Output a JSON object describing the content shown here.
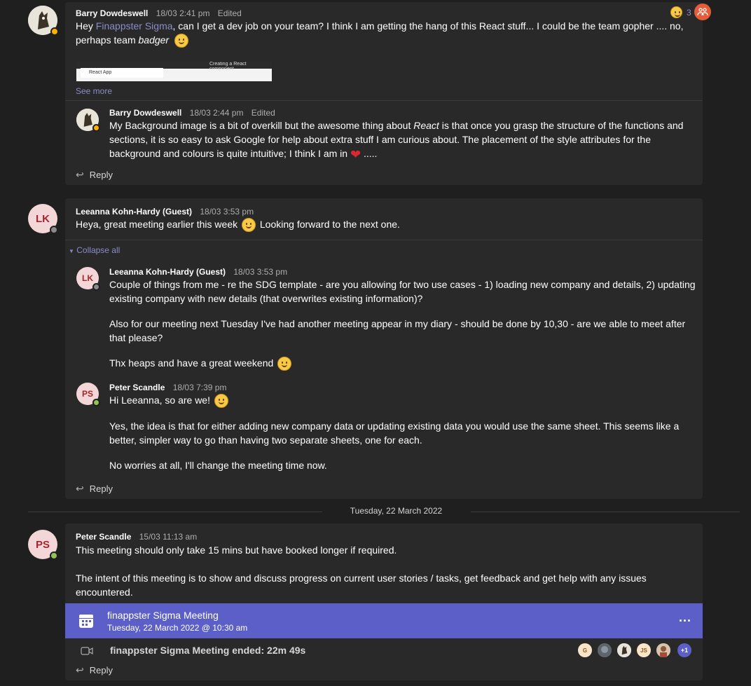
{
  "thread1": {
    "author": "Barry Dowdeswell",
    "time": "18/03 2:41 pm",
    "edited": "Edited",
    "text_pre": "Hey ",
    "mention": "Finappster Sigma",
    "text_post": ", can I get a dev job on your team? I think I am getting the hang of this React stuff... I could be the team gopher .... no, perhaps team ",
    "text_italic": "badger",
    "reaction_count": "3",
    "preview_tab": "React App",
    "preview_tab2": "Creating a React component",
    "see_more": "See more",
    "reply": {
      "author": "Barry Dowdeswell",
      "time": "18/03 2:44 pm",
      "edited": "Edited",
      "text_a": "My Background image is a bit of overkill but the awesome thing about ",
      "text_italic": "React",
      "text_b": " is that once you grasp the structure of the functions and sections, it is so easy to ask Google for help about extra stuff I am curious about. The placement of the style attributes for the background and colours is quite intuitive; I think I am in ",
      "text_end": " ....."
    },
    "reply_label": "Reply"
  },
  "thread2": {
    "initials": "LK",
    "author": "Leeanna Kohn-Hardy (Guest)",
    "time": "18/03 3:53 pm",
    "text_a": "Heya, great meeting earlier this week ",
    "text_b": " Looking forward to the next one.",
    "collapse": "Collapse all",
    "r1": {
      "initials": "LK",
      "author": "Leeanna Kohn-Hardy (Guest)",
      "time": "18/03 3:53 pm",
      "p1": "Couple of things from me - re the SDG template - are you allowing for two use cases - 1) loading new company and details, 2) updating existing company with new details (that overwrites existing information)?",
      "p2": "Also for our meeting next Tuesday I've had another meeting appear in my diary - should be done by 10,30 - are we able to meet after that please?",
      "p3": "Thx heaps and have a great weekend "
    },
    "r2": {
      "initials": "PS",
      "author": "Peter Scandle",
      "time": "18/03 7:39 pm",
      "p1": "Hi Leeanna, so are we! ",
      "p2": "Yes, the idea is that for either adding new company data or updating existing data you would use the same sheet. This seems like a better, simpler way to go than having two separate sheets, one for each.",
      "p3": "No worries at all, I'll change the meeting time now."
    },
    "reply_label": "Reply"
  },
  "date_separator": "Tuesday, 22 March 2022",
  "thread3": {
    "initials": "PS",
    "author": "Peter Scandle",
    "time": "15/03 11:13 am",
    "p1": "This meeting should only take 15 mins but have booked longer if required.",
    "p2": "The intent of this meeting is to show and discuss progress on current user stories / tasks, get feedback and get help with any issues encountered.",
    "meeting_title": "finappster Sigma Meeting",
    "meeting_time": "Tuesday, 22 March 2022 @ 10:30 am",
    "more": "...",
    "ended": "finappster Sigma Meeting ended: 22m 49s",
    "participants": [
      "G",
      "JS",
      "+1"
    ],
    "reply_label": "Reply"
  },
  "colors": {
    "accent": "#5b5fc7",
    "background": "#1f1f1f",
    "card": "#292929",
    "mention": "#8b8cc7"
  }
}
